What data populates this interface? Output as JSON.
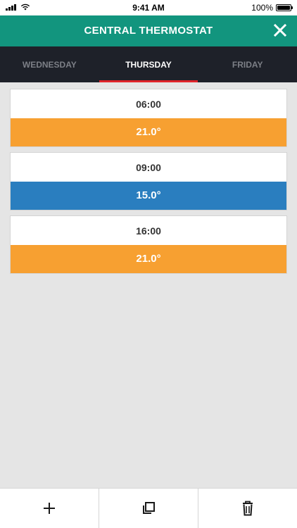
{
  "status_bar": {
    "time": "9:41 AM",
    "battery": "100%",
    "battery_level": 1.0
  },
  "header": {
    "title": "CENTRAL THERMOSTAT",
    "close_icon": "close-icon"
  },
  "tabs": [
    {
      "label": "WEDNESDAY",
      "active": false
    },
    {
      "label": "THURSDAY",
      "active": true
    },
    {
      "label": "FRIDAY",
      "active": false
    }
  ],
  "schedule": [
    {
      "time": "06:00",
      "temperature": "21.0°",
      "color": "#f7a031"
    },
    {
      "time": "09:00",
      "temperature": "15.0°",
      "color": "#2a7ebf"
    },
    {
      "time": "16:00",
      "temperature": "21.0°",
      "color": "#f7a031"
    }
  ],
  "toolbar": {
    "add_icon": "plus-icon",
    "copy_icon": "copy-icon",
    "delete_icon": "trash-icon"
  },
  "colors": {
    "header": "#12957e",
    "tab_bar": "#1e2129",
    "tab_indicator": "#e0242b",
    "warm": "#f7a031",
    "cool": "#2a7ebf"
  }
}
